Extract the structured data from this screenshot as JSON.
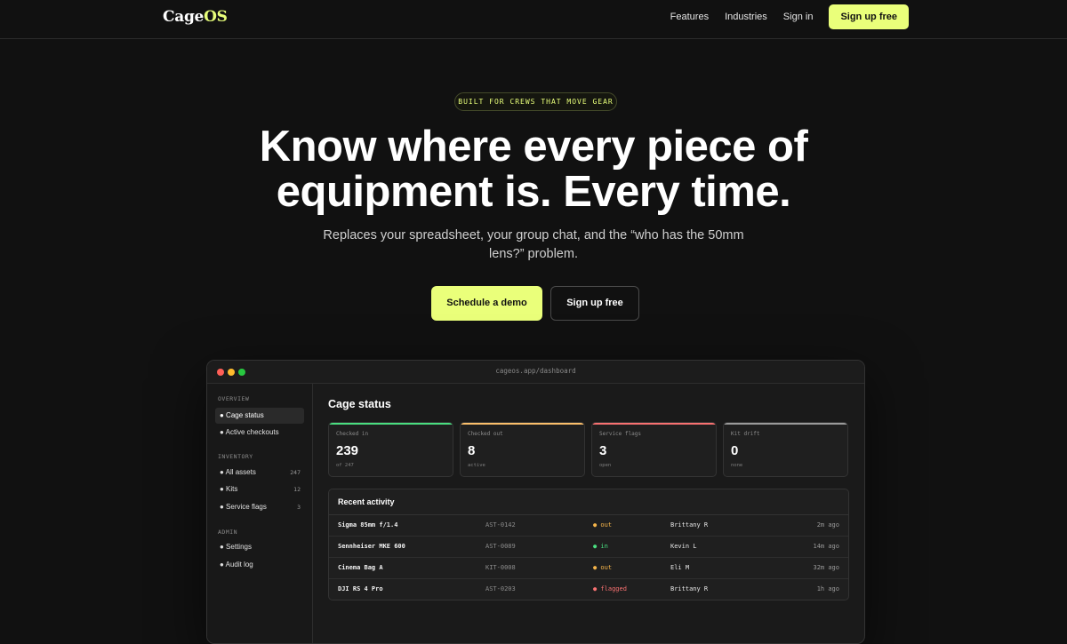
{
  "brand": {
    "logo_main": "Cage",
    "logo_accent": "OS",
    "accent_color": "#eaff7a"
  },
  "nav": {
    "links": [
      "Features",
      "Industries",
      "Sign in"
    ],
    "cta": "Sign up free"
  },
  "hero": {
    "badge": "BUILT FOR CREWS THAT MOVE GEAR",
    "headline_line1": "Know where every piece of",
    "headline_line2": "equipment is. Every time.",
    "subtitle": "Replaces your spreadsheet, your group chat, and the “who has the 50mm lens?” problem.",
    "primary_cta": "Schedule a demo",
    "secondary_cta": "Sign up free"
  },
  "dashboard": {
    "url": "cageos.app/dashboard",
    "window_dots": [
      "#ff5f57",
      "#febc2e",
      "#28c840"
    ],
    "sidebar": {
      "overview_label": "OVERVIEW",
      "overview_items": [
        {
          "label": "● Cage status"
        },
        {
          "label": "● Active checkouts"
        }
      ],
      "inventory_label": "INVENTORY",
      "inventory_items": [
        {
          "label": "● All assets",
          "count": "247"
        },
        {
          "label": "● Kits",
          "count": "12"
        },
        {
          "label": "● Service flags",
          "count": "3"
        }
      ],
      "admin_label": "ADMIN",
      "admin_items": [
        {
          "label": "● Settings"
        },
        {
          "label": "● Audit log"
        }
      ]
    },
    "title": "Cage status",
    "stats": [
      {
        "label": "Checked in",
        "value": "239",
        "note": "of 247",
        "color": "#4ade80"
      },
      {
        "label": "Checked out",
        "value": "8",
        "note": "active",
        "color": "#fbbf6b"
      },
      {
        "label": "Service flags",
        "value": "3",
        "note": "open",
        "color": "#f87171"
      },
      {
        "label": "Kit drift",
        "value": "0",
        "note": "none",
        "color": "#9a9a9a"
      }
    ],
    "activity": {
      "title": "Recent activity",
      "status_colors": {
        "out": "#f5b44a",
        "in": "#4ade80",
        "flagged": "#f87171"
      },
      "rows": [
        {
          "name": "Sigma 85mm f/1.4",
          "id": "AST-0142",
          "status": "● out",
          "user": "Brittany R",
          "time": "2m ago"
        },
        {
          "name": "Sennheiser MKE 600",
          "id": "AST-0089",
          "status": "● in",
          "user": "Kevin L",
          "time": "14m ago"
        },
        {
          "name": "Cinema Bag A",
          "id": "KIT-0008",
          "status": "● out",
          "user": "Eli M",
          "time": "32m ago"
        },
        {
          "name": "DJI RS 4 Pro",
          "id": "AST-0203",
          "status": "● flagged",
          "user": "Brittany R",
          "time": "1h ago"
        }
      ]
    }
  }
}
